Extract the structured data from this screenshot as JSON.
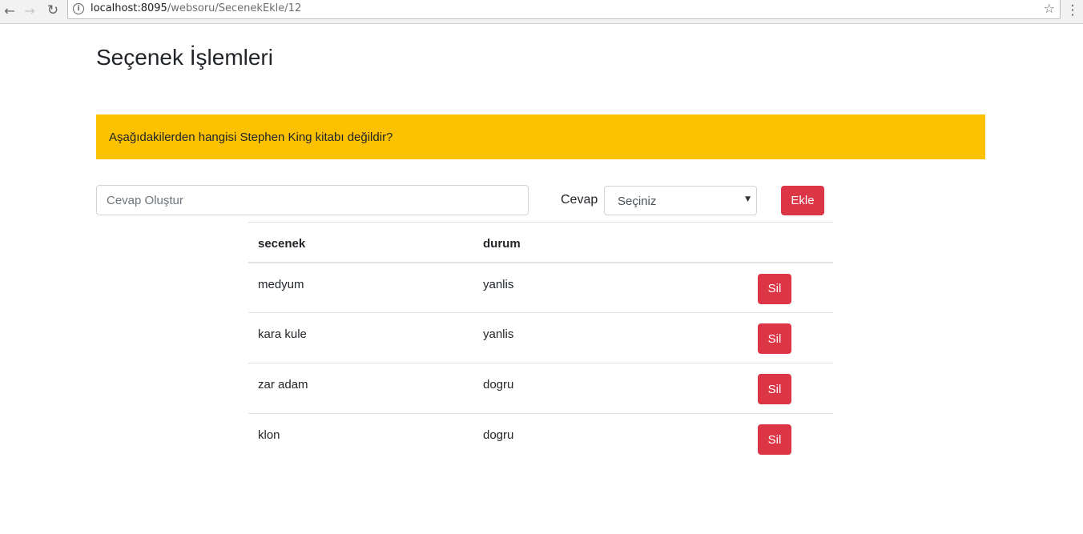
{
  "browser": {
    "url_host": "localhost:8095",
    "url_path": "/websoru/SecenekEkle/12"
  },
  "page": {
    "title": "Seçenek İşlemleri"
  },
  "question": {
    "text": "Aşağıdakilerden hangisi Stephen King kitabı değildir?",
    "color": "#fcc100"
  },
  "form": {
    "answer_placeholder": "Cevap Oluştur",
    "cevap_label": "Cevap",
    "select_value": "Seçiniz",
    "add_label": "Ekle"
  },
  "table": {
    "headers": [
      "secenek",
      "durum",
      ""
    ],
    "rows": [
      {
        "secenek": "medyum",
        "durum": "yanlis",
        "action": "Sil"
      },
      {
        "secenek": "kara kule",
        "durum": "yanlis",
        "action": "Sil"
      },
      {
        "secenek": "zar adam",
        "durum": "dogru",
        "action": "Sil"
      },
      {
        "secenek": "klon",
        "durum": "dogru",
        "action": "Sil"
      }
    ]
  },
  "colors": {
    "danger": "#dc3545"
  }
}
